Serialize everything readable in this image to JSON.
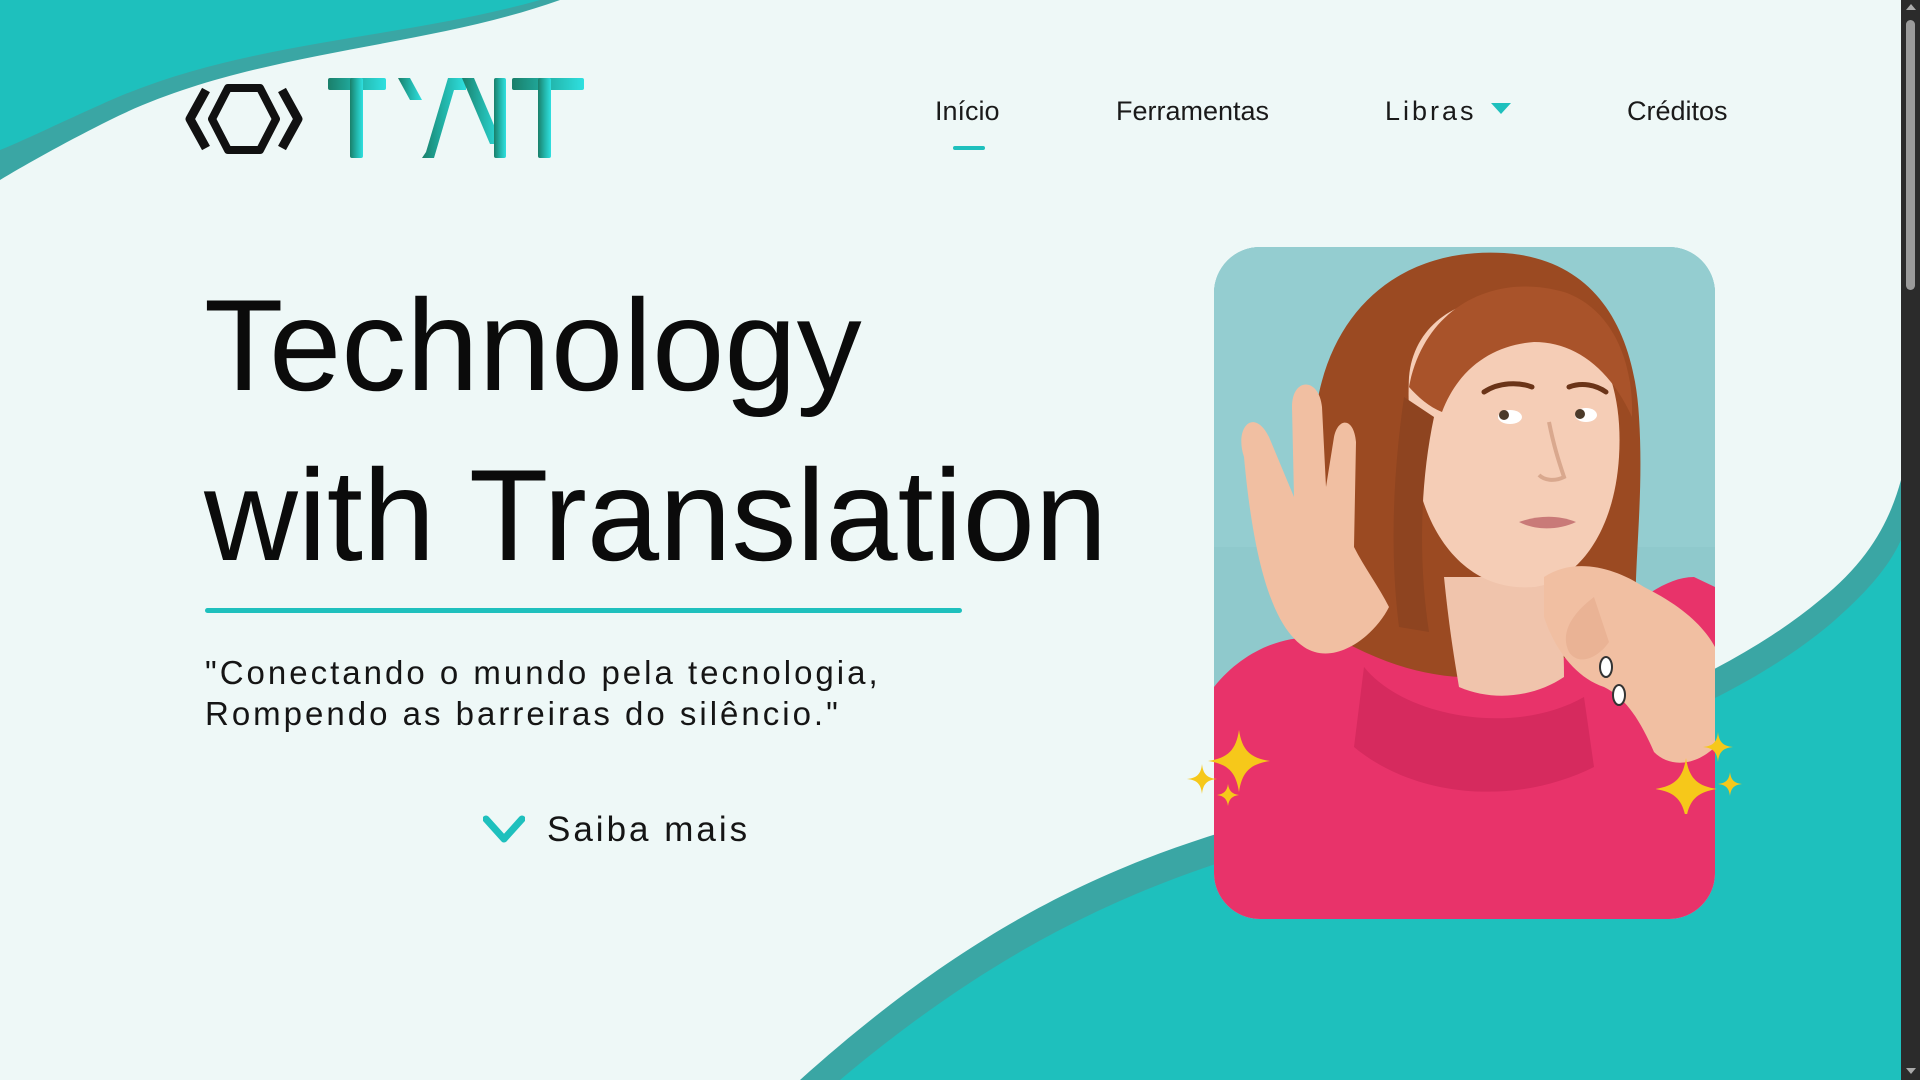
{
  "brand": {
    "logo_text": "T'NT",
    "logo_icon": "hexagon-brackets-icon"
  },
  "nav": {
    "items": [
      {
        "label": "Início",
        "active": true
      },
      {
        "label": "Ferramentas"
      },
      {
        "label": "Libras",
        "has_dropdown": true,
        "dropdown_icon": "caret-down-icon"
      },
      {
        "label": "Créditos"
      }
    ]
  },
  "hero": {
    "title_line1": "Technology",
    "title_line2": "with Translation",
    "quote_line1": "\"Conectando o mundo pela tecnologia,",
    "quote_line2": "Rompendo as barreiras do silêncio.\"",
    "cta_label": "Saiba mais",
    "cta_icon": "chevron-down-icon",
    "image_subject": "woman-listening-hand-to-ear",
    "sparkle_icon": "sparkles-icon"
  },
  "colors": {
    "accent": "#1ec0bd",
    "accent_dark": "#3aa6a4",
    "background": "#eef8f7",
    "sweater": "#e8336a",
    "sparkle": "#f6c81a"
  }
}
